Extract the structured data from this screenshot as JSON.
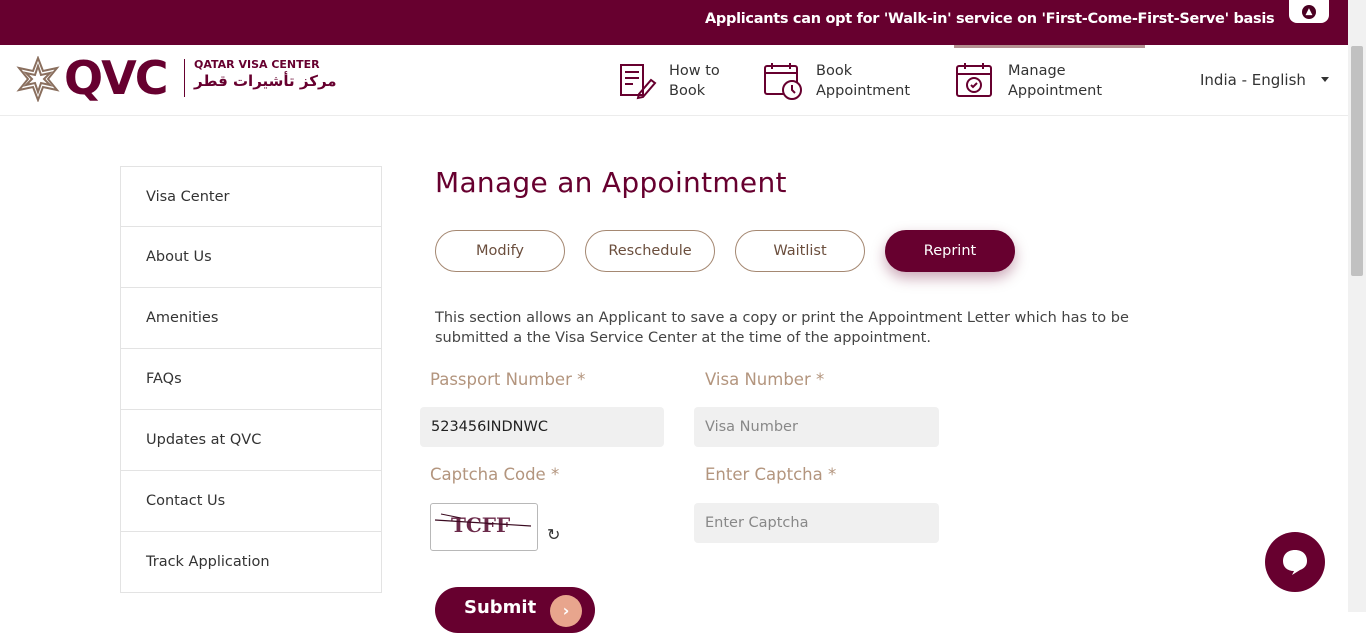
{
  "announcement": "Applicants can opt for 'Walk-in' service on 'First-Come-First-Serve' basis",
  "logo": {
    "text": "QVC",
    "name_en": "QATAR VISA CENTER",
    "name_ar": "مركز تأشيرات قطر"
  },
  "nav": [
    {
      "label": "How to Book",
      "icon": "document-edit-icon"
    },
    {
      "label": "Book Appointment",
      "icon": "calendar-clock-icon"
    },
    {
      "label": "Manage Appointment",
      "icon": "calendar-check-icon"
    }
  ],
  "language": "India - English",
  "sidebar": [
    {
      "label": "Visa Center"
    },
    {
      "label": "About Us"
    },
    {
      "label": "Amenities"
    },
    {
      "label": "FAQs"
    },
    {
      "label": "Updates at QVC"
    },
    {
      "label": "Contact Us"
    },
    {
      "label": "Track Application"
    }
  ],
  "page": {
    "title": "Manage an Appointment",
    "tabs": [
      {
        "label": "Modify"
      },
      {
        "label": "Reschedule"
      },
      {
        "label": "Waitlist"
      },
      {
        "label": "Reprint",
        "active": true
      }
    ],
    "description": "This section allows an Applicant to save a copy or print the Appointment Letter which has to be submitted a the Visa Service Center at the time of the appointment.",
    "passport": {
      "label": "Passport Number *",
      "value": "523456INDNWC"
    },
    "visa": {
      "label": "Visa Number *",
      "placeholder": "Visa Number"
    },
    "captcha": {
      "label": "Captcha Code *",
      "code": "TCFF"
    },
    "enter_captcha": {
      "label": "Enter Captcha *",
      "placeholder": "Enter Captcha"
    },
    "submit_label": "Submit"
  },
  "colors": {
    "brand": "#67002f",
    "label": "#b3957e",
    "accent": "#e8a58d"
  }
}
